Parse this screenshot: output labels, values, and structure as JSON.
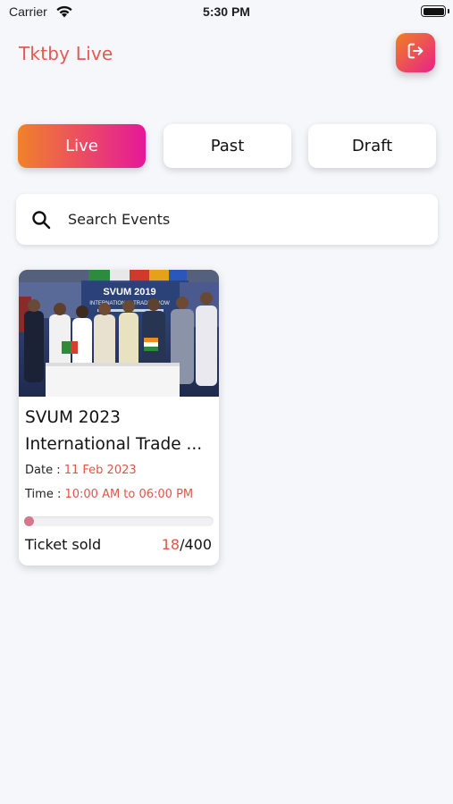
{
  "status_bar": {
    "carrier": "Carrier",
    "time": "5:30 PM"
  },
  "header": {
    "title": "Tktby Live",
    "logout_icon": "logout-icon"
  },
  "tabs": [
    {
      "label": "Live",
      "active": true
    },
    {
      "label": "Past",
      "active": false
    },
    {
      "label": "Draft",
      "active": false
    }
  ],
  "search": {
    "placeholder": "Search Events",
    "value": ""
  },
  "events": [
    {
      "title_line1": "SVUM 2023",
      "title_line2": "International Trade ...",
      "date_label": "Date : ",
      "date_value": "11 Feb 2023",
      "time_label": "Time : ",
      "time_value": "10:00 AM to 06:00 PM",
      "ticket_label": "Ticket sold",
      "tickets_sold": "18",
      "tickets_separator": "/",
      "tickets_total": "400",
      "sold_fraction": 0.045,
      "image_banner_text": "SVUM 2019",
      "image_banner_subtext": "INTERNATIONAL TRADE SHOW"
    }
  ],
  "colors": {
    "accent_orange": "#f0822a",
    "accent_pink": "#e6189a",
    "brand_red": "#e45a50",
    "background": "#f6f7fb"
  }
}
